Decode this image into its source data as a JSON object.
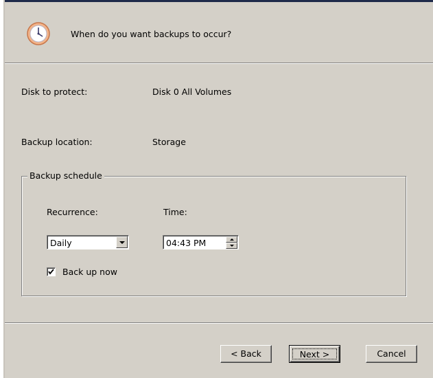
{
  "header": {
    "title": "When do you want backups to occur?",
    "icon": "clock-icon"
  },
  "fields": {
    "disk_label": "Disk to protect:",
    "disk_value": "Disk 0 All Volumes",
    "location_label": "Backup location:",
    "location_value": "Storage"
  },
  "schedule": {
    "legend": "Backup schedule",
    "recurrence_label": "Recurrence:",
    "recurrence_value": "Daily",
    "time_label": "Time:",
    "time_value": "04:43 PM",
    "backup_now_label": "Back up now",
    "backup_now_checked": true
  },
  "buttons": {
    "back": "< Back",
    "next": "Next >",
    "cancel": "Cancel"
  },
  "colors": {
    "dialog_bg": "#d4d0c8",
    "clock_face": "#ffffff",
    "clock_ring": "#e8a070"
  }
}
